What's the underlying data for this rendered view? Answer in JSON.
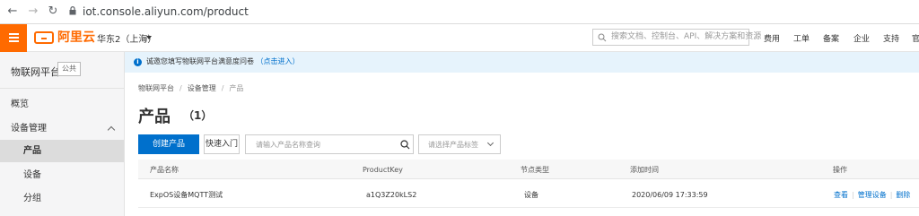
{
  "browser": {
    "back_icon": "arrow-left-icon",
    "forward_icon": "arrow-right-icon",
    "reload_icon": "reload-icon",
    "url": "iot.console.aliyun.com/product"
  },
  "header": {
    "brand": "阿里云",
    "region": "华东2（上海）",
    "search_placeholder": "搜索文档、控制台、API、解决方案和资源",
    "nav": [
      "费用",
      "工单",
      "备案",
      "企业",
      "支持",
      "官"
    ],
    "accent_color": "#ff6a00"
  },
  "sidebar": {
    "title": "物联网平台",
    "badge": "公共",
    "items": [
      {
        "label": "概览"
      },
      {
        "label": "设备管理"
      },
      {
        "label": "产品"
      },
      {
        "label": "设备"
      },
      {
        "label": "分组"
      }
    ]
  },
  "notice": {
    "text": "诚邀您填写物联网平台满意度问卷",
    "link": "（点击进入）"
  },
  "breadcrumb": [
    "物联网平台",
    "设备管理",
    "产品"
  ],
  "page": {
    "title": "产品",
    "count": "（1）"
  },
  "toolbar": {
    "create_label": "创建产品",
    "quick_label": "快速入门",
    "search_placeholder": "请输入产品名称查询",
    "tag_placeholder": "请选择产品标签"
  },
  "table": {
    "columns": [
      "产品名称",
      "ProductKey",
      "节点类型",
      "添加时间",
      "操作"
    ],
    "rows": [
      {
        "name": "ExpOS设备MQTT测试",
        "product_key": "a1Q3Z20kLS2",
        "node_type": "设备",
        "created": "2020/06/09 17:33:59",
        "actions": [
          "查看",
          "管理设备",
          "删除"
        ]
      }
    ]
  },
  "colors": {
    "primary": "#0070cc",
    "notice_bg": "#e6f3fc"
  }
}
